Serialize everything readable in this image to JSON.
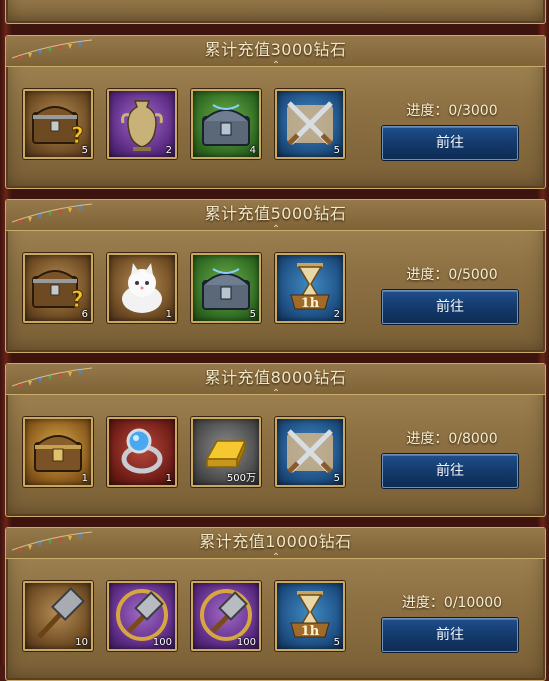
{
  "cards": [
    {
      "title": "累计充值3000钻石",
      "progress": "进度：0/3000",
      "button": "前往",
      "items": [
        {
          "icon": "mystery-chest-icon",
          "qty": "5"
        },
        {
          "icon": "vase-icon",
          "qty": "2"
        },
        {
          "icon": "silver-chest-icon",
          "qty": "4"
        },
        {
          "icon": "crossed-swords-icon",
          "qty": "5"
        }
      ]
    },
    {
      "title": "累计充值5000钻石",
      "progress": "进度：0/5000",
      "button": "前往",
      "items": [
        {
          "icon": "mystery-chest-icon",
          "qty": "6"
        },
        {
          "icon": "white-cat-icon",
          "qty": "1"
        },
        {
          "icon": "silver-chest-icon",
          "qty": "5"
        },
        {
          "icon": "hourglass-1h-icon",
          "qty": "2",
          "label": "1h"
        }
      ]
    },
    {
      "title": "累计充值8000钻石",
      "progress": "进度：0/8000",
      "button": "前往",
      "items": [
        {
          "icon": "wooden-chest-icon",
          "qty": "1"
        },
        {
          "icon": "sapphire-ring-icon",
          "qty": "1"
        },
        {
          "icon": "gold-bar-icon",
          "qty": "500万"
        },
        {
          "icon": "crossed-swords-icon",
          "qty": "5"
        }
      ]
    },
    {
      "title": "累计充值10000钻石",
      "progress": "进度：0/10000",
      "button": "前往",
      "items": [
        {
          "icon": "war-hammer-icon",
          "qty": "10"
        },
        {
          "icon": "hammer-emblem-icon",
          "qty": "100"
        },
        {
          "icon": "hammer-emblem-icon",
          "qty": "100"
        },
        {
          "icon": "hourglass-1h-icon",
          "qty": "5",
          "label": "1h"
        }
      ]
    }
  ]
}
